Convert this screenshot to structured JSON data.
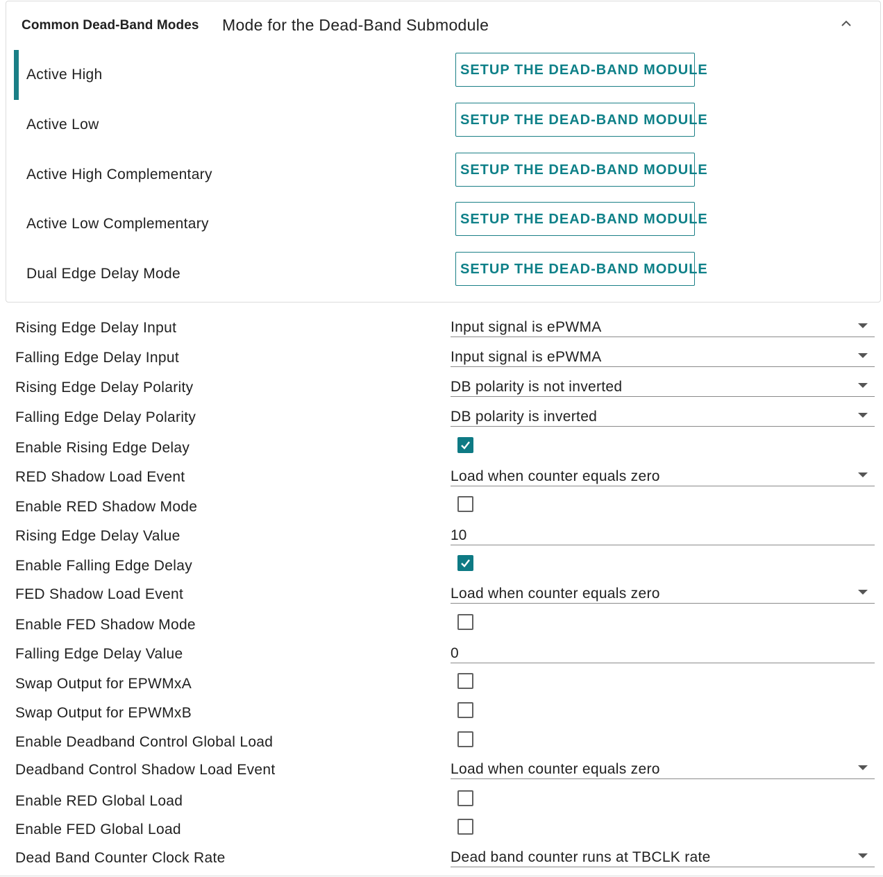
{
  "panel": {
    "title": "Common Dead-Band Modes",
    "subtitle": "Mode for the Dead-Band Submodule",
    "collapse_icon": "chevron-up-icon",
    "accent_color": "#1a7f86",
    "modes": [
      {
        "label": "Active High",
        "button": "SETUP THE DEAD-BAND MODULE",
        "selected": true
      },
      {
        "label": "Active Low",
        "button": "SETUP THE DEAD-BAND MODULE",
        "selected": false
      },
      {
        "label": "Active High Complementary",
        "button": "SETUP THE DEAD-BAND MODULE",
        "selected": false
      },
      {
        "label": "Active Low Complementary",
        "button": "SETUP THE DEAD-BAND MODULE",
        "selected": false
      },
      {
        "label": "Dual Edge Delay Mode",
        "button": "SETUP THE DEAD-BAND MODULE",
        "selected": false
      }
    ]
  },
  "settings": [
    {
      "label": "Rising Edge Delay Input",
      "type": "select",
      "value": "Input signal is ePWMA"
    },
    {
      "label": "Falling Edge Delay Input",
      "type": "select",
      "value": "Input signal is ePWMA"
    },
    {
      "label": "Rising Edge Delay Polarity",
      "type": "select",
      "value": "DB polarity is not inverted"
    },
    {
      "label": "Falling Edge Delay Polarity",
      "type": "select",
      "value": "DB polarity is inverted"
    },
    {
      "label": "Enable Rising Edge Delay",
      "type": "checkbox",
      "checked": true
    },
    {
      "label": "RED Shadow Load Event",
      "type": "select",
      "value": "Load when counter equals zero"
    },
    {
      "label": "Enable RED Shadow Mode",
      "type": "checkbox",
      "checked": false
    },
    {
      "label": "Rising Edge Delay Value",
      "type": "text",
      "value": "10"
    },
    {
      "label": "Enable Falling Edge Delay",
      "type": "checkbox",
      "checked": true
    },
    {
      "label": "FED Shadow Load Event",
      "type": "select",
      "value": "Load when counter equals zero"
    },
    {
      "label": "Enable FED Shadow Mode",
      "type": "checkbox",
      "checked": false
    },
    {
      "label": "Falling Edge Delay Value",
      "type": "text",
      "value": "0"
    },
    {
      "label": "Swap Output for EPWMxA",
      "type": "checkbox",
      "checked": false
    },
    {
      "label": "Swap Output for EPWMxB",
      "type": "checkbox",
      "checked": false
    },
    {
      "label": "Enable Deadband Control Global Load",
      "type": "checkbox",
      "checked": false
    },
    {
      "label": "Deadband Control Shadow Load Event",
      "type": "select",
      "value": "Load when counter equals zero"
    },
    {
      "label": "Enable RED Global Load",
      "type": "checkbox",
      "checked": false
    },
    {
      "label": "Enable FED Global Load",
      "type": "checkbox",
      "checked": false
    },
    {
      "label": "Dead Band Counter Clock Rate",
      "type": "select",
      "value": "Dead band counter runs at TBCLK rate"
    }
  ]
}
